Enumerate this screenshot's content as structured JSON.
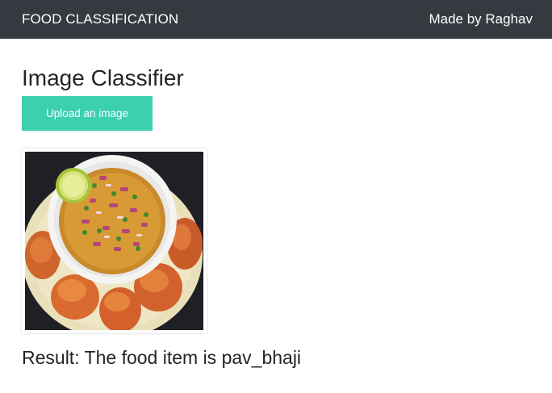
{
  "navbar": {
    "brand": "FOOD CLASSIFICATION",
    "credit": "Made by Raghav",
    "background": "#343a40"
  },
  "main": {
    "title": "Image Classifier",
    "upload_button": {
      "label": "Upload an image",
      "color": "#3ccfb0"
    },
    "uploaded_image": {
      "alt": "pav_bhaji"
    },
    "result_text": "Result: The food item is pav_bhaji"
  }
}
